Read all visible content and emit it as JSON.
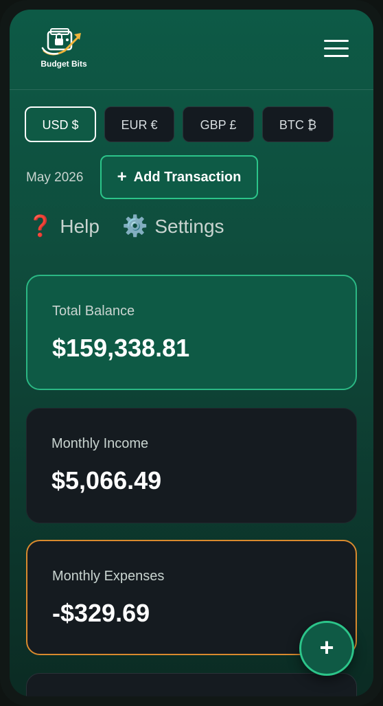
{
  "app": {
    "name": "Budget Bits"
  },
  "header": {
    "menu_icon": "hamburger-menu-icon"
  },
  "currencies": [
    {
      "label": "USD $",
      "active": true
    },
    {
      "label": "EUR €",
      "active": false
    },
    {
      "label": "GBP £",
      "active": false
    },
    {
      "label": "BTC ₿",
      "active": false
    }
  ],
  "toolbar": {
    "month": "May 2026",
    "add_label": "Add Transaction",
    "add_icon": "+"
  },
  "links": {
    "help_icon": "❓",
    "help_label": "Help",
    "settings_icon": "⚙️",
    "settings_label": "Settings"
  },
  "cards": {
    "balance": {
      "label": "Total Balance",
      "value": "$159,338.81"
    },
    "income": {
      "label": "Monthly Income",
      "value": "$5,066.49"
    },
    "expenses": {
      "label": "Monthly Expenses",
      "value": "-$329.69"
    }
  },
  "fab": {
    "label": "+"
  },
  "colors": {
    "accent": "#2cc58a",
    "brand_green": "#0f5a45",
    "card_dark": "#151b20",
    "expense_border": "#d98a2e"
  }
}
